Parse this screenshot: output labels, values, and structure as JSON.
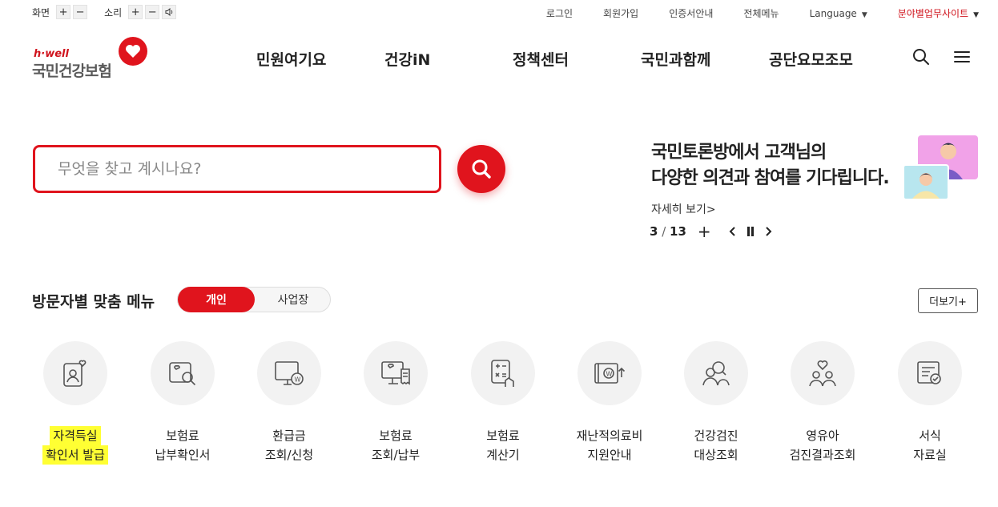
{
  "utility": {
    "screen_label": "화면",
    "sound_label": "소리",
    "plus": "+",
    "minus": "−",
    "links": [
      "로그인",
      "회원가입",
      "인증서안내",
      "전체메뉴"
    ],
    "language": "Language",
    "business_sites": "분야별업무사이트"
  },
  "logo": {
    "tagline": "h·well",
    "name": "국민건강보험"
  },
  "gnb": [
    "민원여기요",
    "건강iN",
    "정책센터",
    "국민과함께",
    "공단요모조모"
  ],
  "search": {
    "placeholder": "무엇을 찾고 계시나요?"
  },
  "banner": {
    "line1": "국민토론방에서 고객님의",
    "line2": "다양한 의견과 참여를 기다립니다.",
    "more": "자세히 보기>",
    "current": "3",
    "sep": " / ",
    "total": "13"
  },
  "section": {
    "title": "방문자별 맞춤 메뉴",
    "tab_personal": "개인",
    "tab_business": "사업장",
    "more": "더보기+"
  },
  "menu": [
    {
      "line1": "자격득실",
      "line2": "확인서 발급",
      "icon": "id-card-heart-icon",
      "highlighted": true
    },
    {
      "line1": "보험료",
      "line2": "납부확인서",
      "icon": "certificate-search-icon"
    },
    {
      "line1": "환급금",
      "line2": "조회/신청",
      "icon": "monitor-won-icon"
    },
    {
      "line1": "보험료",
      "line2": "조회/납부",
      "icon": "computer-receipt-icon"
    },
    {
      "line1": "보험료",
      "line2": "계산기",
      "icon": "calculator-hand-icon"
    },
    {
      "line1": "재난적의료비",
      "line2": "지원안내",
      "icon": "wallet-won-arrow-icon"
    },
    {
      "line1": "건강검진",
      "line2": "대상조회",
      "icon": "person-search-icon"
    },
    {
      "line1": "영유아",
      "line2": "검진결과조회",
      "icon": "family-heart-icon"
    },
    {
      "line1": "서식",
      "line2": "자료실",
      "icon": "document-check-icon"
    }
  ]
}
